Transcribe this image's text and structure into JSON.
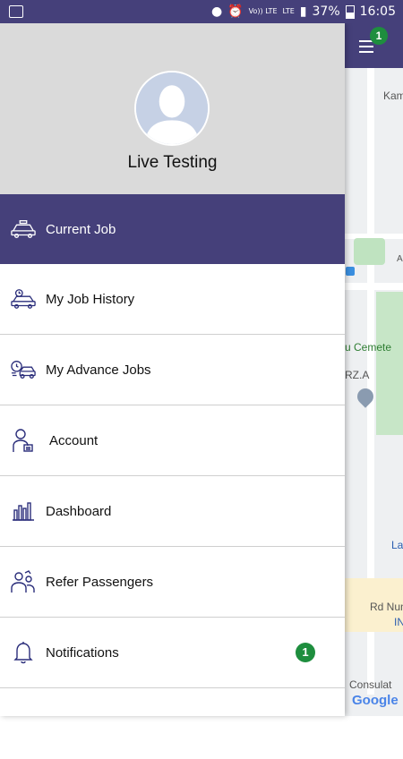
{
  "status_bar": {
    "signal_label": "Vo)) LTE",
    "network_label": "LTE",
    "battery": "37%",
    "time": "16:05"
  },
  "drawer": {
    "profile_name": "Live Testing",
    "items": [
      {
        "label": "Current Job",
        "icon": "taxi-icon",
        "active": true
      },
      {
        "label": "My Job History",
        "icon": "car-history-icon"
      },
      {
        "label": "My Advance Jobs",
        "icon": "car-clock-icon"
      },
      {
        "label": "Account",
        "icon": "account-user-icon"
      },
      {
        "label": "Dashboard",
        "icon": "bar-chart-icon"
      },
      {
        "label": "Refer Passengers",
        "icon": "users-refer-icon"
      },
      {
        "label": "Notifications",
        "icon": "bell-icon",
        "badge": "1"
      }
    ]
  },
  "map": {
    "menu_badge": "1",
    "labels": [
      "Kam",
      "A",
      "u Cemete",
      "RZ.A",
      "La",
      "Rd Num",
      "IN",
      "Consulat",
      "Google"
    ]
  },
  "colors": {
    "primary": "#45407a",
    "badge": "#1e8e3e"
  }
}
